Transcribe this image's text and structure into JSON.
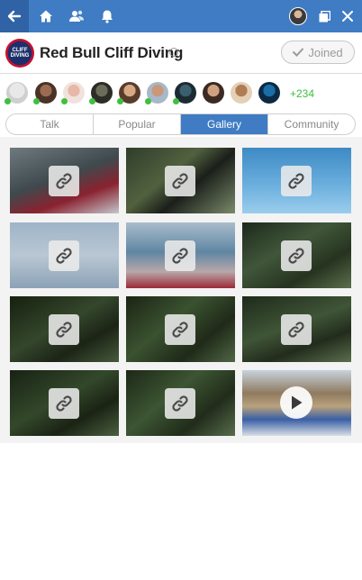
{
  "topbar": {
    "accent": "#3f7cc4",
    "icons": [
      "back-arrow-icon",
      "home-icon",
      "people-icon",
      "bell-icon",
      "user-avatar",
      "windows-icon",
      "close-icon"
    ]
  },
  "group": {
    "name": "Red Bull Cliff Diving",
    "joined_label": "Joined",
    "logo_text": "CLIFF DIVING"
  },
  "members": {
    "more_count": "+234",
    "online_color": "#3fbf3f"
  },
  "tabs": [
    {
      "label": "Talk",
      "active": false
    },
    {
      "label": "Popular",
      "active": false
    },
    {
      "label": "Gallery",
      "active": true
    },
    {
      "label": "Community",
      "active": false
    }
  ],
  "gallery": {
    "items": [
      {
        "kind": "link"
      },
      {
        "kind": "link"
      },
      {
        "kind": "link"
      },
      {
        "kind": "link"
      },
      {
        "kind": "link"
      },
      {
        "kind": "link"
      },
      {
        "kind": "link"
      },
      {
        "kind": "link"
      },
      {
        "kind": "link"
      },
      {
        "kind": "link"
      },
      {
        "kind": "link"
      },
      {
        "kind": "video"
      }
    ]
  }
}
